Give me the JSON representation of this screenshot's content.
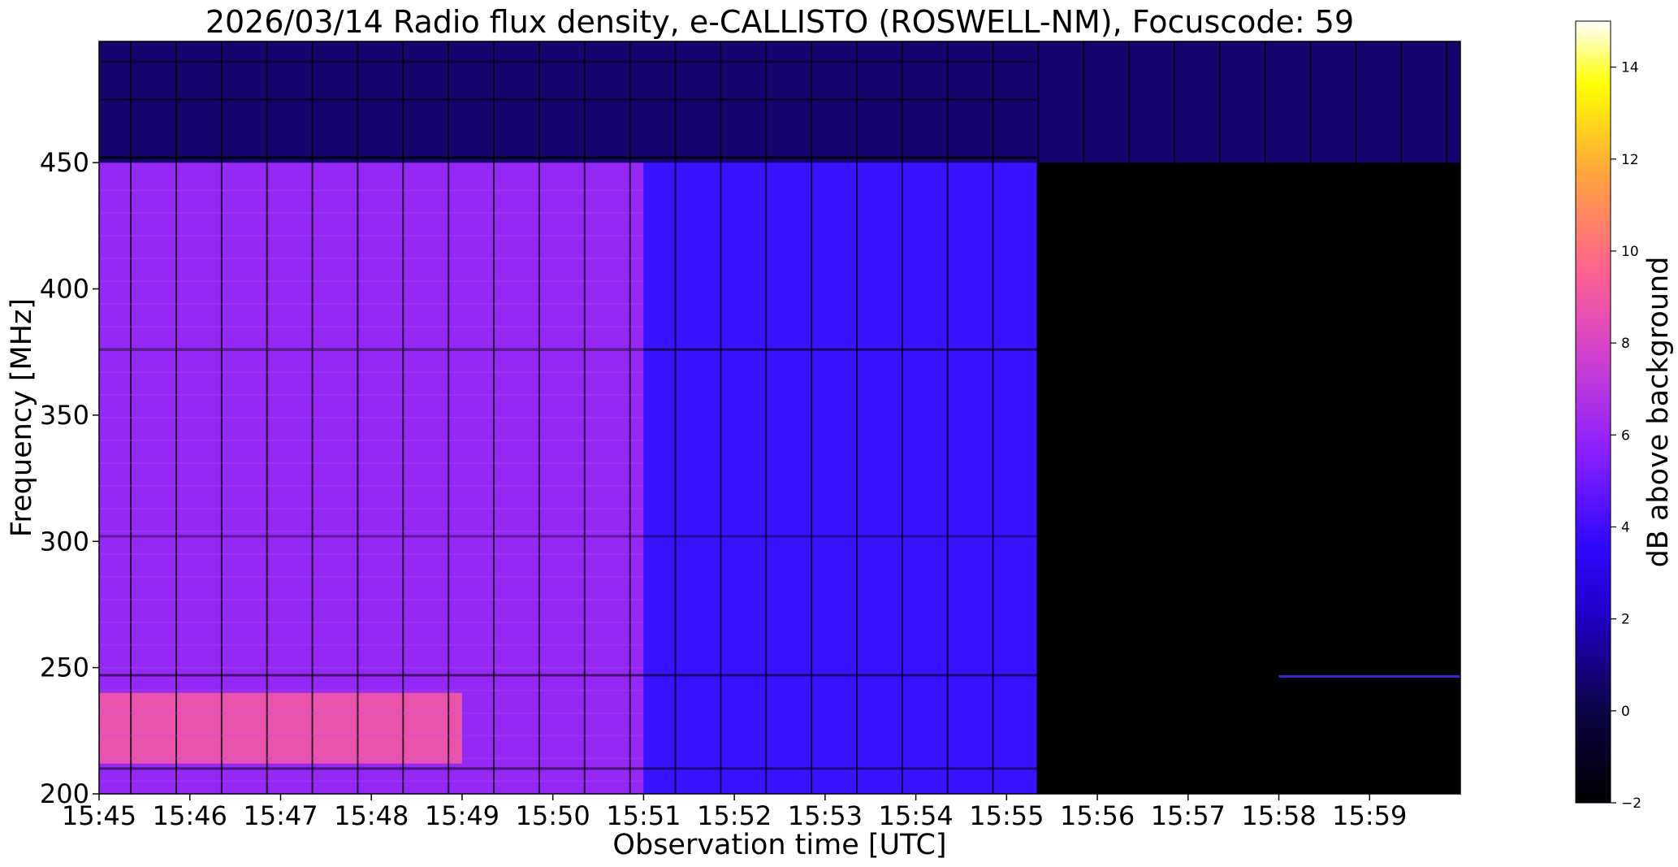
{
  "chart_data": {
    "type": "heatmap",
    "title": "2026/03/14  Radio flux density, e-CALLISTO (ROSWELL-NM), Focuscode: 59",
    "xlabel": "Observation time [UTC]",
    "ylabel": "Frequency [MHz]",
    "x_tick_labels": [
      "15:45",
      "15:46",
      "15:47",
      "15:48",
      "15:49",
      "15:50",
      "15:51",
      "15:52",
      "15:53",
      "15:54",
      "15:55",
      "15:56",
      "15:57",
      "15:58",
      "15:59"
    ],
    "xlim_minutes": [
      0,
      15
    ],
    "y_ticks": [
      200,
      250,
      300,
      350,
      400,
      450
    ],
    "ylim": [
      200,
      498
    ],
    "colorbar": {
      "label": "dB above background",
      "ticks": [
        -2,
        0,
        2,
        4,
        6,
        8,
        10,
        12,
        14
      ],
      "range": [
        -2,
        15
      ],
      "colormap": "gnuplot2"
    },
    "intensity_regions": [
      {
        "time_range": [
          "15:45",
          "15:51"
        ],
        "freq_range": [
          200,
          450
        ],
        "approx_db": 5
      },
      {
        "time_range": [
          "15:51",
          "15:55:20"
        ],
        "freq_range": [
          200,
          450
        ],
        "approx_db": 2.5
      },
      {
        "time_range": [
          "15:55:20",
          "16:00"
        ],
        "freq_range": [
          200,
          450
        ],
        "approx_db": -2
      },
      {
        "time_range": [
          "15:45",
          "16:00"
        ],
        "freq_range": [
          450,
          498
        ],
        "approx_db": 0.5
      },
      {
        "time_range": [
          "15:45",
          "15:49"
        ],
        "freq_range": [
          212,
          240
        ],
        "approx_db": 7.5
      }
    ]
  }
}
